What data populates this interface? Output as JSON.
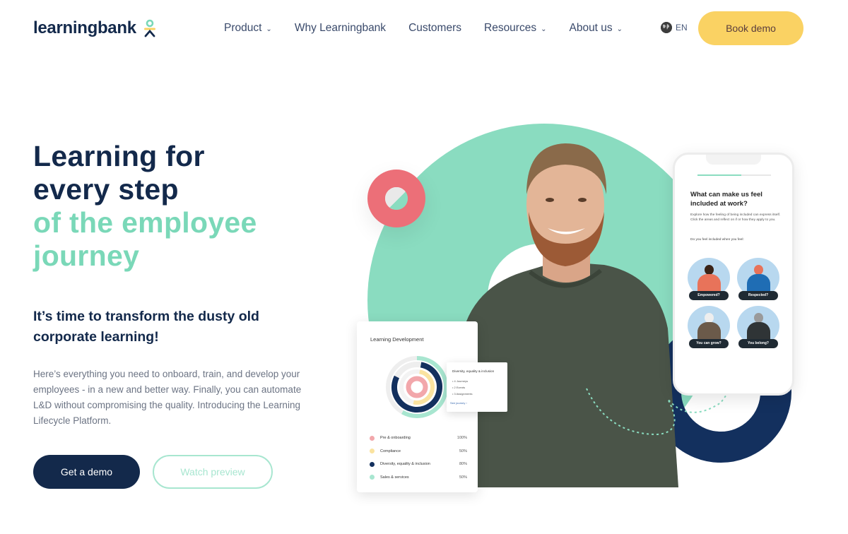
{
  "brand": {
    "name": "learningbank",
    "colors": {
      "navy": "#13294b",
      "mint": "#7ad8b8",
      "yellow": "#fad263",
      "coral": "#ec6f78"
    }
  },
  "nav": {
    "items": [
      {
        "label": "Product",
        "has_dropdown": true
      },
      {
        "label": "Why Learningbank",
        "has_dropdown": false
      },
      {
        "label": "Customers",
        "has_dropdown": false
      },
      {
        "label": "Resources",
        "has_dropdown": true
      },
      {
        "label": "About us",
        "has_dropdown": true
      }
    ],
    "chevron": "⌄",
    "language": "EN",
    "cta": "Book demo"
  },
  "hero": {
    "title_dark_1": "Learning for",
    "title_dark_2": "every step",
    "title_mint_1": "of the employee",
    "title_mint_2": "journey",
    "subtitle": "It’s time to transform the dusty old corporate learning!",
    "body": "Here’s everything you need to onboard, train, and develop your employees - in a new and better way. Finally, you can automate L&D without compromising the quality. Introducing the Learning Lifecycle Platform.",
    "primary_button": "Get a demo",
    "secondary_button": "Watch preview"
  },
  "learning_card": {
    "title": "Learning Development",
    "legend": [
      {
        "label": "Pre & onboarding",
        "value": "100%",
        "color": "#f2a7ab"
      },
      {
        "label": "Compliance",
        "value": "50%",
        "color": "#fae3a0"
      },
      {
        "label": "Diversity, equality & inclusion",
        "value": "80%",
        "color": "#13305e"
      },
      {
        "label": "Sales & services",
        "value": "50%",
        "color": "#a8e6d0"
      }
    ],
    "tooltip": {
      "title": "Diversity, equality & inclusion",
      "items": [
        "4 Journeys",
        "2 Events",
        "3 Assignments"
      ],
      "link": "See journey  ›"
    }
  },
  "phone": {
    "progress": 0.6,
    "title": "What can make us feel included at work?",
    "description": "Explore how the feeling of being included can express itself. Click the areas and reflect on if or how they apply to you.",
    "question": "Do you feel included when you feel:",
    "options": [
      "Empowered?",
      "Respected?",
      "You can grow?",
      "You belong?"
    ]
  }
}
